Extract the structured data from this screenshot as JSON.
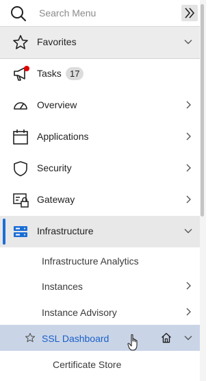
{
  "search": {
    "placeholder": "Search Menu"
  },
  "favorites": {
    "label": "Favorites"
  },
  "nav": {
    "tasks": {
      "label": "Tasks",
      "badge": "17"
    },
    "overview": {
      "label": "Overview"
    },
    "applications": {
      "label": "Applications"
    },
    "security": {
      "label": "Security"
    },
    "gateway": {
      "label": "Gateway"
    },
    "infrastructure": {
      "label": "Infrastructure",
      "children": [
        {
          "label": "Infrastructure Analytics"
        },
        {
          "label": "Instances"
        },
        {
          "label": "Instance Advisory"
        },
        {
          "label": "SSL Dashboard"
        },
        {
          "label": "Certificate Store"
        }
      ]
    }
  },
  "colors": {
    "accent": "#1b6ed6",
    "selected_bg": "#c9d5e7",
    "selected_text": "#1b5fc7",
    "notification_dot": "#e00000"
  },
  "icons": [
    "search-icon",
    "collapse-menu-icon",
    "star-icon",
    "megaphone-icon",
    "gauge-icon",
    "calendar-icon",
    "shield-icon",
    "gateway-lock-icon",
    "server-icon",
    "chevron-down-icon",
    "chevron-right-icon",
    "home-icon",
    "hand-cursor-icon"
  ]
}
